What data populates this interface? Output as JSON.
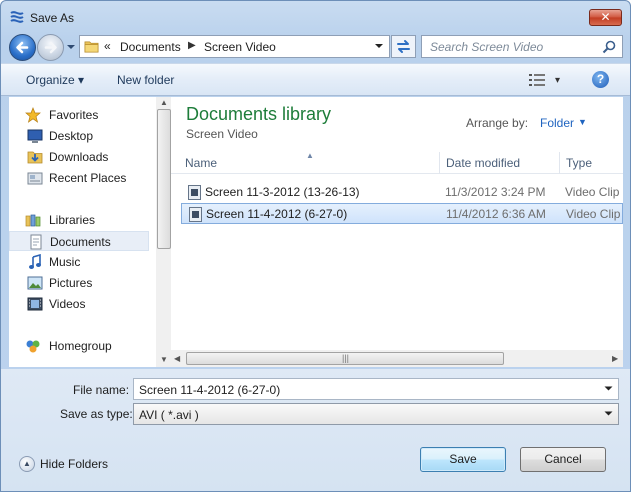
{
  "window": {
    "title": "Save As",
    "close_glyph": "✕"
  },
  "nav": {
    "address": {
      "chevron": "«",
      "segments": [
        "Documents",
        "Screen Video"
      ],
      "separator": "▶"
    },
    "search": {
      "placeholder": "Search Screen Video"
    }
  },
  "toolbar": {
    "organize": "Organize ▾",
    "new_folder": "New folder",
    "views_drop": "▾",
    "help": "?"
  },
  "sidebar": {
    "items": [
      {
        "label": "Favorites",
        "icon": "star-icon"
      },
      {
        "label": "Desktop",
        "icon": "desktop-icon"
      },
      {
        "label": "Downloads",
        "icon": "downloads-icon"
      },
      {
        "label": "Recent Places",
        "icon": "recent-places-icon"
      },
      {
        "label": "Libraries",
        "icon": "libraries-icon"
      },
      {
        "label": "Documents",
        "icon": "documents-icon",
        "selected": true
      },
      {
        "label": "Music",
        "icon": "music-icon"
      },
      {
        "label": "Pictures",
        "icon": "pictures-icon"
      },
      {
        "label": "Videos",
        "icon": "videos-icon"
      },
      {
        "label": "Homegroup",
        "icon": "homegroup-icon"
      }
    ]
  },
  "content": {
    "library_title": "Documents library",
    "library_subtitle": "Screen Video",
    "arrange_label": "Arrange by:",
    "arrange_value": "Folder",
    "columns": {
      "name": "Name",
      "date": "Date modified",
      "type": "Type"
    },
    "files": [
      {
        "name": "Screen 11-3-2012 (13-26-13)",
        "date": "11/3/2012 3:24 PM",
        "type": "Video Clip",
        "selected": false
      },
      {
        "name": "Screen 11-4-2012 (6-27-0)",
        "date": "11/4/2012 6:36 AM",
        "type": "Video Clip",
        "selected": true
      }
    ]
  },
  "form": {
    "file_name_label": "File name:",
    "file_name_value": "Screen 11-4-2012 (6-27-0)",
    "save_type_label": "Save as type:",
    "save_type_value": "AVI ( *.avi )"
  },
  "footer": {
    "hide_folders": "Hide Folders",
    "save": "Save",
    "cancel": "Cancel"
  },
  "colors": {
    "library_title": "#1e7d3a",
    "link": "#1f64c0",
    "selection": "#cfe3fb"
  }
}
